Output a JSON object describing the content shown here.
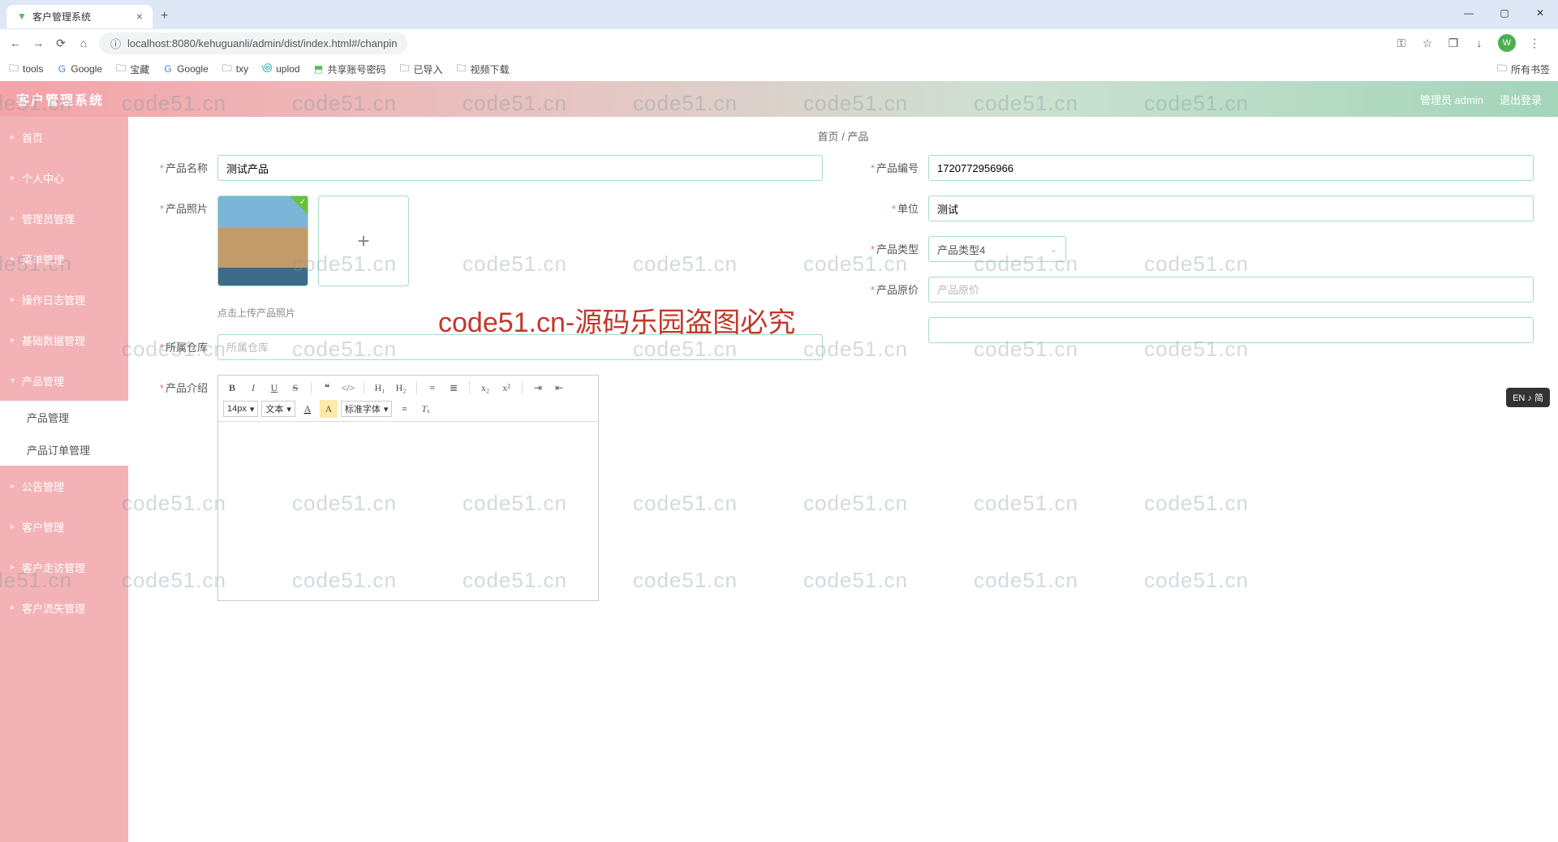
{
  "browser": {
    "tab_title": "客户管理系统",
    "url": "localhost:8080/kehuguanli/admin/dist/index.html#/chanpin",
    "bookmarks": [
      "tools",
      "Google",
      "宝藏",
      "Google",
      "txy",
      "uplod",
      "共享账号密码",
      "已导入",
      "视频下载"
    ],
    "all_bookmarks": "所有书签",
    "avatar": "W"
  },
  "header": {
    "title": "客户管理系统",
    "user": "管理员 admin",
    "logout": "退出登录"
  },
  "sidebar": {
    "items": [
      {
        "label": "首页"
      },
      {
        "label": "个人中心"
      },
      {
        "label": "管理员管理"
      },
      {
        "label": "菜单管理"
      },
      {
        "label": "操作日志管理"
      },
      {
        "label": "基础数据管理"
      },
      {
        "label": "产品管理"
      },
      {
        "label": "产品管理",
        "sub": true
      },
      {
        "label": "产品订单管理",
        "sub": true
      },
      {
        "label": "公告管理"
      },
      {
        "label": "客户管理"
      },
      {
        "label": "客户走访管理"
      },
      {
        "label": "客户流失管理"
      }
    ]
  },
  "breadcrumb": {
    "home": "首页",
    "sep": "/",
    "current": "产品"
  },
  "form": {
    "product_name": {
      "label": "产品名称",
      "value": "测试产品"
    },
    "product_photo": {
      "label": "产品照片",
      "hint": "点击上传产品照片"
    },
    "warehouse": {
      "label": "所属仓库",
      "placeholder": "所属仓库",
      "value": ""
    },
    "product_intro": {
      "label": "产品介绍"
    },
    "product_code": {
      "label": "产品编号",
      "value": "1720772956966"
    },
    "unit": {
      "label": "单位",
      "value": "测试"
    },
    "product_type": {
      "label": "产品类型",
      "value": "产品类型4"
    },
    "original_price": {
      "label": "产品原价",
      "placeholder": "产品原价",
      "value": ""
    },
    "extra_field": {
      "value": ""
    }
  },
  "editor": {
    "font_size": "14px",
    "text_style": "文本",
    "font_family": "标准字体"
  },
  "watermark": {
    "small": "code51.cn",
    "big": "code51.cn-源码乐园盗图必究"
  },
  "ime": "EN ♪ 简"
}
